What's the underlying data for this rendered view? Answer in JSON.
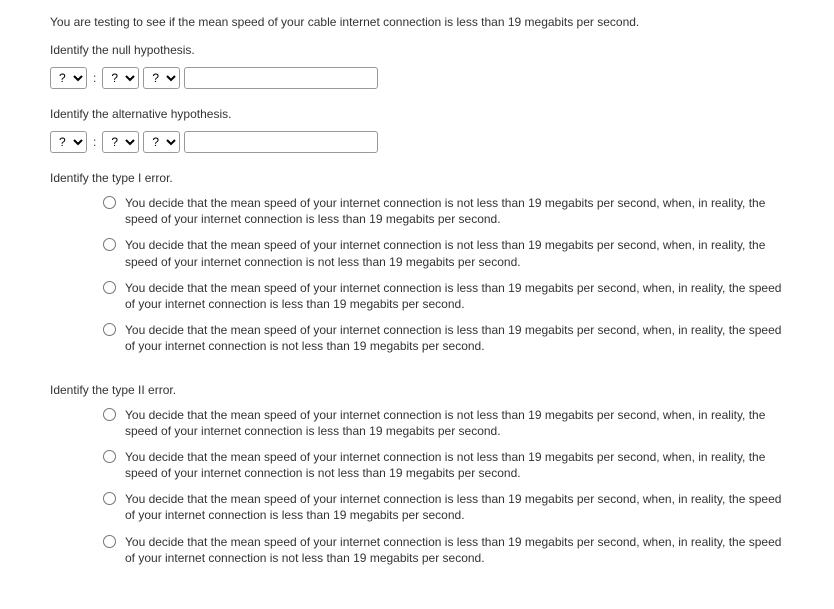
{
  "intro": "You are testing to see if the mean speed of your cable internet connection is less than 19 megabits per second.",
  "null_label": "Identify the null hypothesis.",
  "alt_label": "Identify the alternative hypothesis.",
  "dropdown_placeholder": "?",
  "colon": ":",
  "type1_label": "Identify the type I error.",
  "type2_label": "Identify the type II error.",
  "options": {
    "a": "You decide that the mean speed of your internet connection is not less than 19 megabits per second, when, in reality, the speed of your internet connection is less than 19 megabits per second.",
    "b": "You decide that the mean speed of your internet connection is not less than 19 megabits per second, when, in reality, the speed of your internet connection is not less than 19 megabits per second.",
    "c": "You decide that the mean speed of your internet connection is less than 19 megabits per second, when, in reality, the speed of your internet connection is less than 19 megabits per second.",
    "d": "You decide that the mean speed of your internet connection is less than 19 megabits per second, when, in reality, the speed of your internet connection is not less than 19 megabits per second."
  }
}
